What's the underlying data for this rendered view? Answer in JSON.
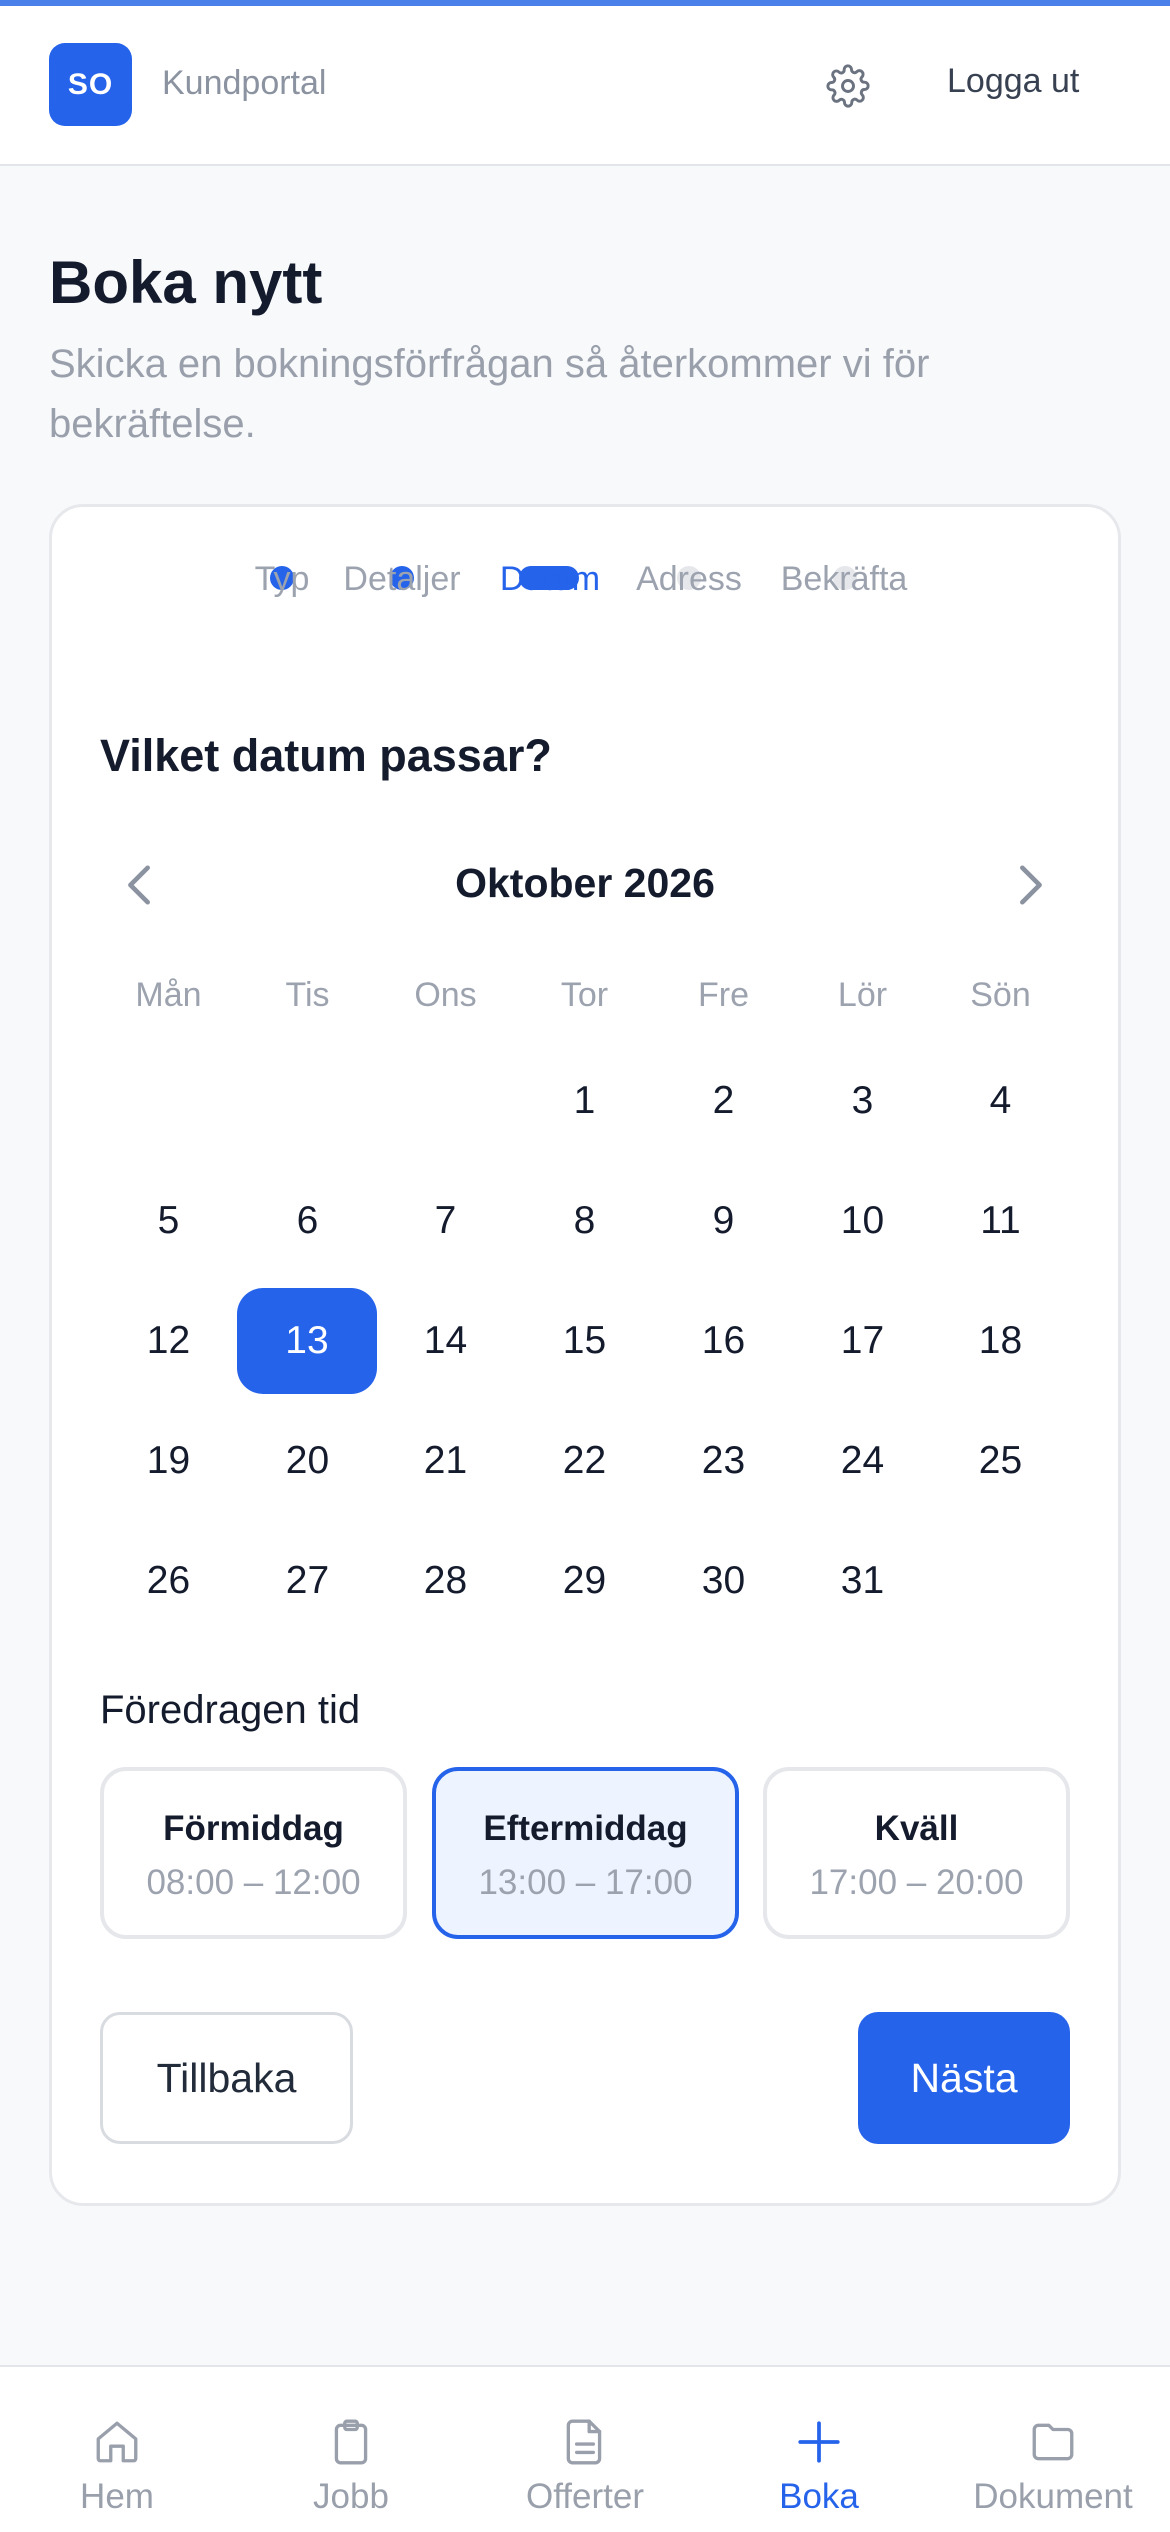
{
  "header": {
    "logo_text": "SO",
    "brand": "Kundportal",
    "logout": "Logga ut"
  },
  "page": {
    "title": "Boka nytt",
    "subtitle": "Skicka en bokningsförfrågan så återkommer vi för bekräftelse."
  },
  "steps": [
    {
      "label": "Typ",
      "state": "done"
    },
    {
      "label": "Detaljer",
      "state": "done"
    },
    {
      "label": "Datum",
      "state": "active"
    },
    {
      "label": "Adress",
      "state": "todo"
    },
    {
      "label": "Bekräfta",
      "state": "todo"
    }
  ],
  "calendar": {
    "question": "Vilket datum passar?",
    "month_label": "Oktober 2026",
    "weekdays": [
      "Mån",
      "Tis",
      "Ons",
      "Tor",
      "Fre",
      "Lör",
      "Sön"
    ],
    "days": [
      "1",
      "2",
      "3",
      "4",
      "5",
      "6",
      "7",
      "8",
      "9",
      "10",
      "11",
      "12",
      "13",
      "14",
      "15",
      "16",
      "17",
      "18",
      "19",
      "20",
      "21",
      "22",
      "23",
      "24",
      "25",
      "26",
      "27",
      "28",
      "29",
      "30",
      "31"
    ],
    "selected_day": "13"
  },
  "time": {
    "label": "Föredragen tid",
    "slots": [
      {
        "name": "Förmiddag",
        "time": "08:00 – 12:00"
      },
      {
        "name": "Eftermiddag",
        "time": "13:00 – 17:00"
      },
      {
        "name": "Kväll",
        "time": "17:00 – 20:00"
      }
    ],
    "selected": "Eftermiddag"
  },
  "actions": {
    "back": "Tillbaka",
    "next": "Nästa"
  },
  "tabs": [
    {
      "label": "Hem",
      "icon": "home-icon"
    },
    {
      "label": "Jobb",
      "icon": "clipboard-icon"
    },
    {
      "label": "Offerter",
      "icon": "document-icon"
    },
    {
      "label": "Boka",
      "icon": "plus-icon"
    },
    {
      "label": "Dokument",
      "icon": "folder-icon"
    }
  ],
  "active_tab": "Boka",
  "colors": {
    "accent": "#2563eb",
    "muted": "#9ca3af",
    "text": "#141b2d"
  }
}
